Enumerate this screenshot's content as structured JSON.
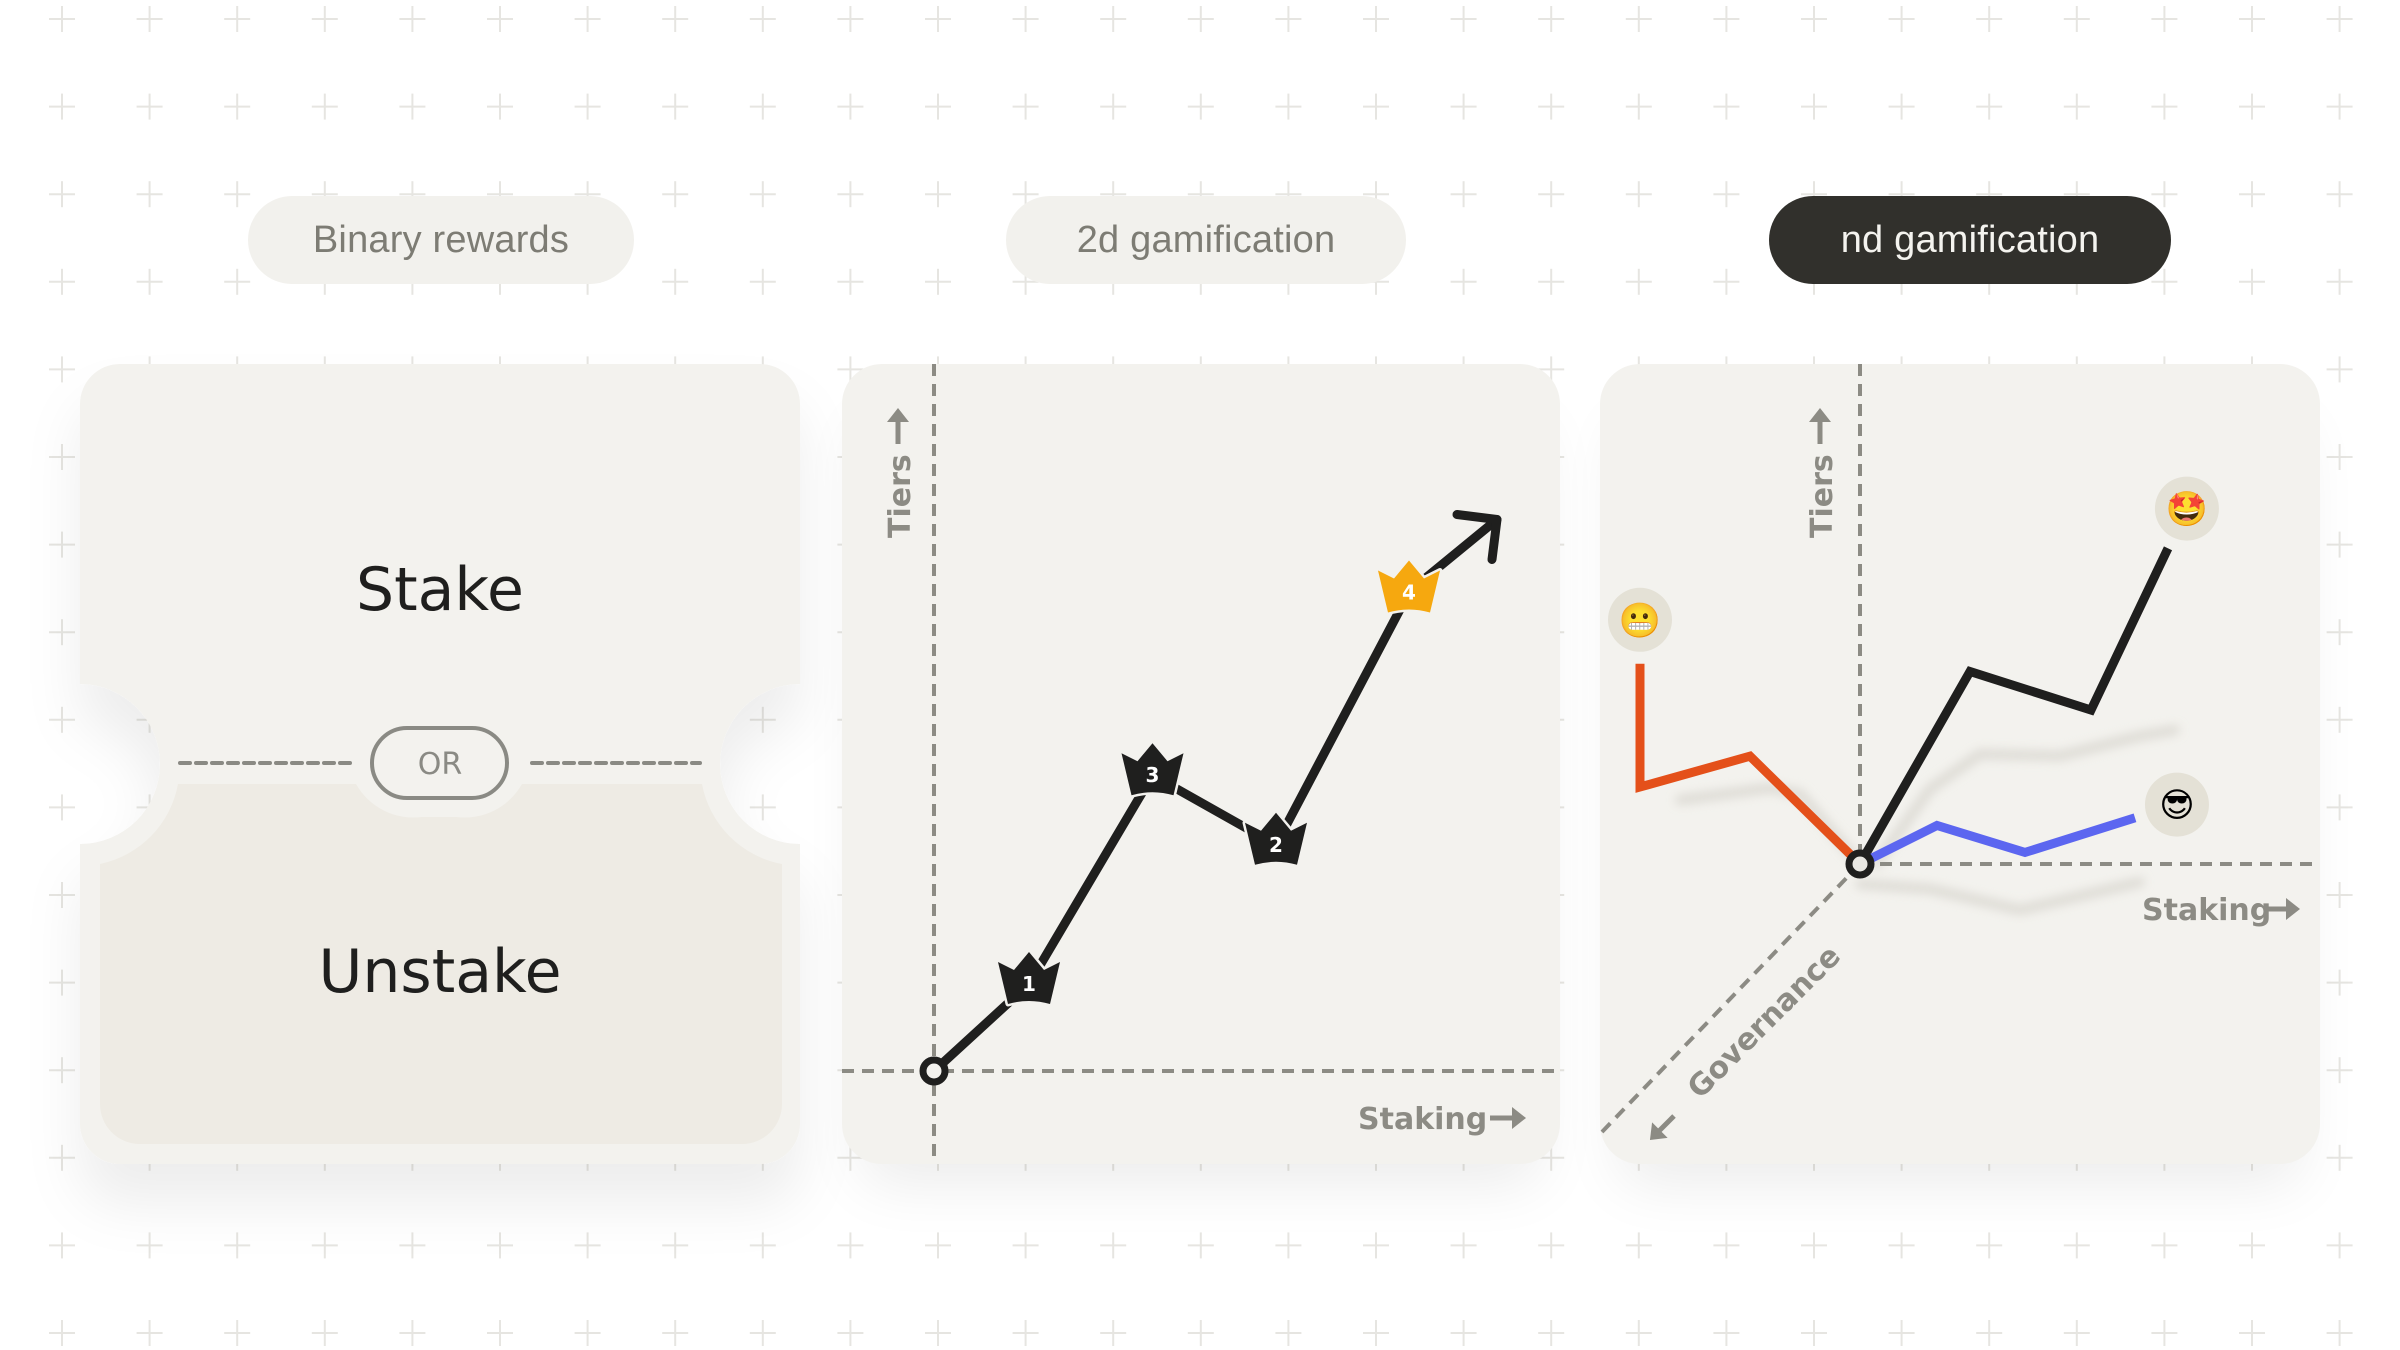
{
  "colors": {
    "background": "#ffffff",
    "grid_cross": "#e6e5e1",
    "card": "#f3f2ee",
    "inner_panel": "#eeebe4",
    "pill_inactive_bg": "#f2f1ed",
    "pill_inactive_text": "#7d7c74",
    "pill_active_bg": "#31302c",
    "pill_active_text": "#f4f3ef",
    "axis": "#8c8b84",
    "line_dark": "#1f1f1e",
    "crown_gold": "#f6a80f",
    "line_orange": "#e4501a",
    "line_blue": "#5c66f0",
    "emoji_bg": "#e4e1d6"
  },
  "tabs": [
    {
      "label": "Binary rewards",
      "active": false
    },
    {
      "label": "2d gamification",
      "active": false
    },
    {
      "label": "nd gamification",
      "active": true
    }
  ],
  "binary_card": {
    "top_label": "Stake",
    "bottom_label": "Unstake",
    "divider_label": "OR"
  },
  "chart_2d": {
    "y_axis_label": "Tiers",
    "x_axis_label": "Staking",
    "up_arrow_icon": "arrow-up-icon",
    "right_arrow_icon": "arrow-right-icon",
    "origin_icon": "origin-circle-icon",
    "trend_arrow_icon": "trend-arrow-icon",
    "crowns": [
      {
        "label": "1",
        "order": 1,
        "color": "dark"
      },
      {
        "label": "3",
        "order": 2,
        "color": "dark"
      },
      {
        "label": "2",
        "order": 3,
        "color": "dark"
      },
      {
        "label": "4",
        "order": 4,
        "color": "gold"
      }
    ]
  },
  "chart_nd": {
    "y_axis_label": "Tiers",
    "x_axis_label": "Staking",
    "z_axis_label": "Governance",
    "series": [
      {
        "name": "orange-path",
        "color": "#e4501a",
        "emoji": "😬",
        "emoji_name": "grimacing-face-icon"
      },
      {
        "name": "black-path",
        "color": "#1f1f1e",
        "emoji": "🤩",
        "emoji_name": "star-struck-face-icon"
      },
      {
        "name": "blue-path",
        "color": "#5c66f0",
        "emoji": "😎",
        "emoji_name": "sunglasses-face-icon"
      }
    ]
  },
  "chart_data": [
    {
      "type": "line",
      "title": "2d gamification",
      "xlabel": "Staking",
      "ylabel": "Tiers",
      "grid": false,
      "points": [
        {
          "x": 0,
          "y": 0,
          "label": "origin"
        },
        {
          "x": 1,
          "y": 1,
          "label": "1"
        },
        {
          "x": 2.3,
          "y": 3.4,
          "label": "3"
        },
        {
          "x": 3.6,
          "y": 2.6,
          "label": "2"
        },
        {
          "x": 5.0,
          "y": 5.5,
          "label": "4"
        }
      ]
    },
    {
      "type": "line",
      "title": "nd gamification",
      "xlabel": "Staking",
      "ylabel": "Tiers",
      "zlabel": "Governance",
      "grid": false,
      "series": [
        {
          "name": "grimacing",
          "values": [
            [
              0,
              0
            ],
            [
              -1,
              1.4
            ],
            [
              -2,
              1.0
            ],
            [
              -2,
              2.6
            ]
          ]
        },
        {
          "name": "star-struck",
          "values": [
            [
              0,
              0
            ],
            [
              1,
              2.5
            ],
            [
              2.1,
              2.0
            ],
            [
              2.8,
              4.1
            ]
          ]
        },
        {
          "name": "sunglasses",
          "values": [
            [
              0,
              0
            ],
            [
              0.7,
              0.5
            ],
            [
              1.5,
              0.15
            ],
            [
              2.5,
              0.6
            ]
          ]
        }
      ]
    }
  ]
}
